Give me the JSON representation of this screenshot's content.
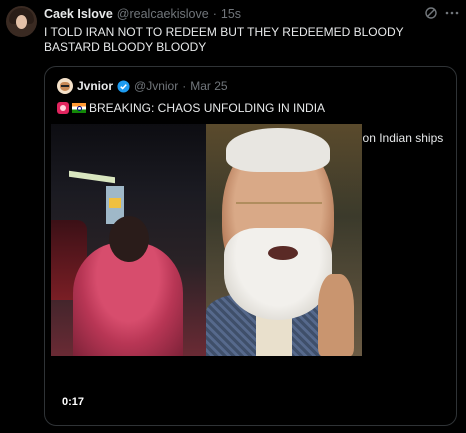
{
  "tweet": {
    "name": "Caek Islove",
    "handle": "@realcaekislove",
    "separator": "·",
    "time": "15s",
    "text": "I TOLD IRAN NOT TO REDEEM BUT THEY REDEEMED BLOODY BASTARD BLOODY BLOODY"
  },
  "quote": {
    "name": "Jvnior",
    "handle": "@Jvnior",
    "separator": "·",
    "date": "Mar 25",
    "headline": "BREAKING: CHAOS UNFOLDING IN INDIA",
    "body": "India is facing severe fuel and gas shortages due to BAN on Indian ships in the Strait of Hormuz.",
    "ellipsis": "...",
    "media": {
      "duration": "0:17"
    }
  },
  "icons": {
    "grok": "grok-icon",
    "more": "more-icon",
    "verified": "verified-icon",
    "siren": "siren-icon",
    "flag": "india-flag-icon"
  },
  "colors": {
    "background": "#000000",
    "text": "#e7e9ea",
    "muted": "#71767b",
    "border": "#2f3336",
    "verified": "#1d9bf0"
  }
}
